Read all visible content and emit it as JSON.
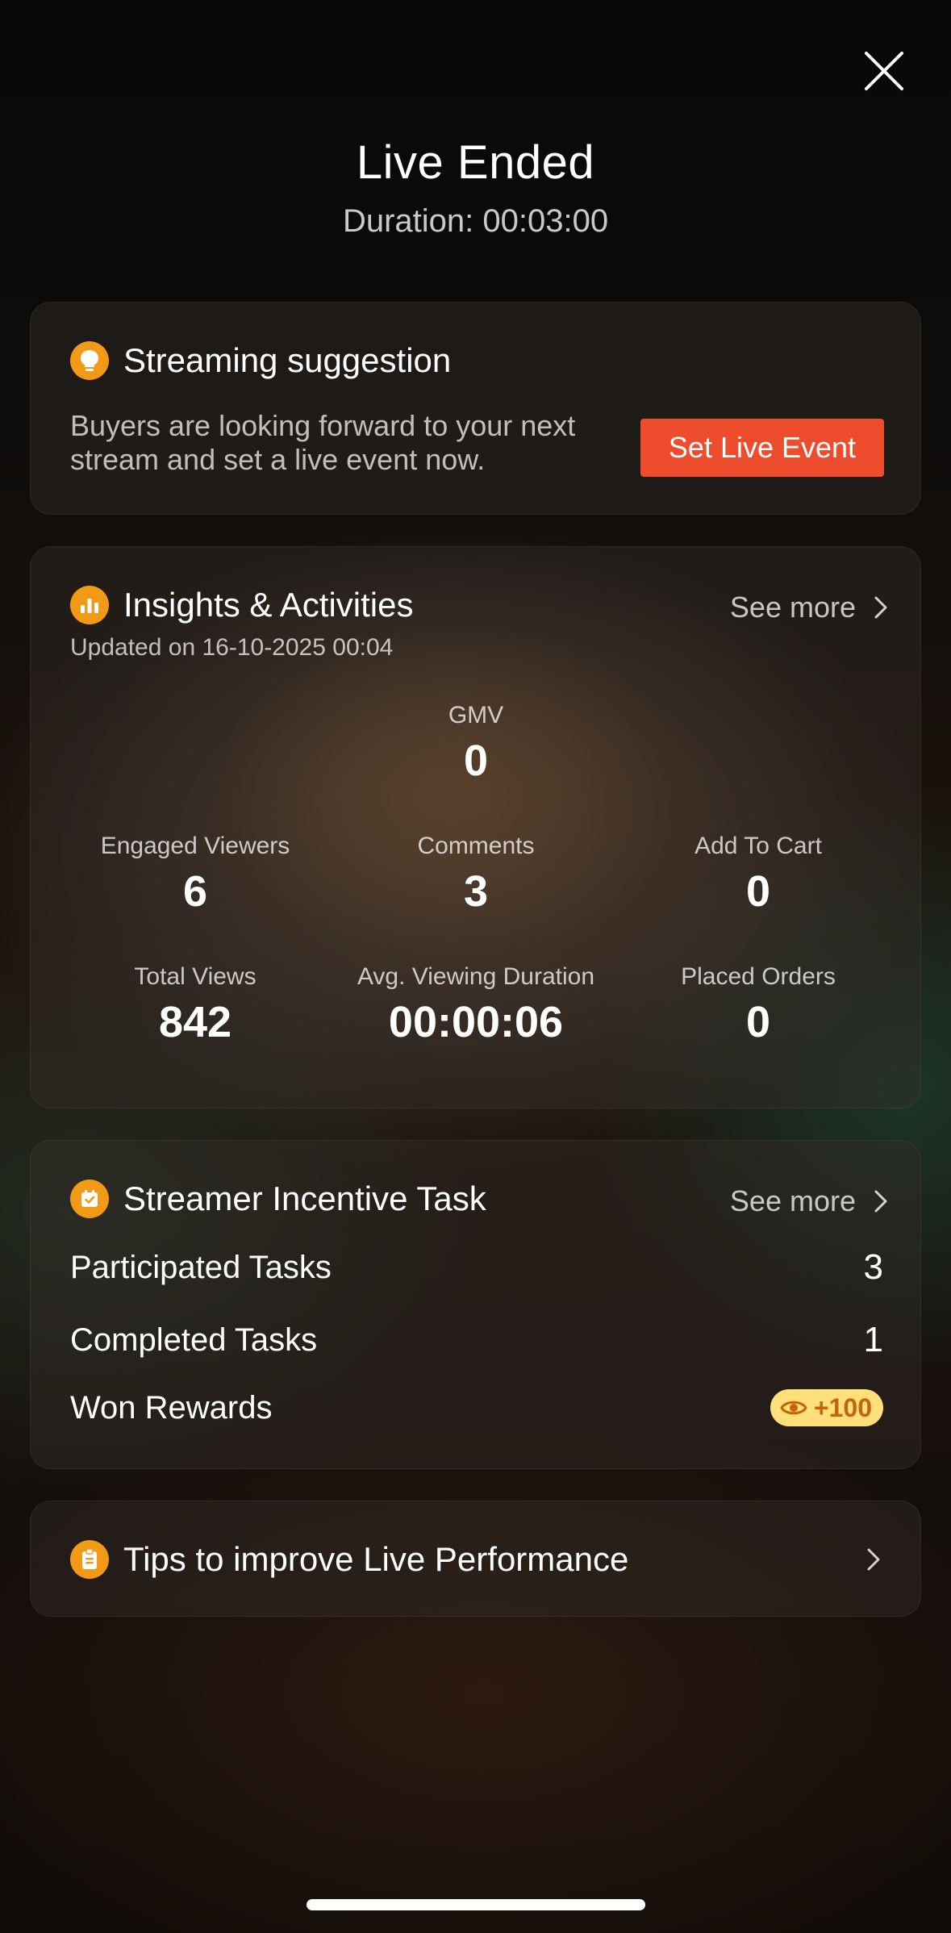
{
  "header": {
    "title": "Live Ended",
    "duration": "Duration: 00:03:00"
  },
  "suggestion": {
    "title": "Streaming suggestion",
    "icon": "lightbulb-icon",
    "text": "Buyers are looking forward to your next stream and set a live event now.",
    "button_label": "Set Live Event"
  },
  "insights": {
    "title": "Insights & Activities",
    "icon": "bar-chart-icon",
    "see_more": "See more",
    "updated": "Updated on 16-10-2025 00:04",
    "gmv": {
      "label": "GMV",
      "value": "0"
    },
    "metrics": [
      {
        "label": "Engaged Viewers",
        "value": "6"
      },
      {
        "label": "Comments",
        "value": "3"
      },
      {
        "label": "Add To Cart",
        "value": "0"
      },
      {
        "label": "Total Views",
        "value": "842"
      },
      {
        "label": "Avg. Viewing Duration",
        "value": "00:00:06"
      },
      {
        "label": "Placed Orders",
        "value": "0"
      }
    ]
  },
  "incentive": {
    "title": "Streamer Incentive Task",
    "icon": "calendar-check-icon",
    "see_more": "See more",
    "rows": [
      {
        "label": "Participated Tasks",
        "value": "3"
      },
      {
        "label": "Completed Tasks",
        "value": "1"
      },
      {
        "label": "Won Rewards",
        "value": "+100"
      }
    ]
  },
  "tips": {
    "title": "Tips to improve Live Performance",
    "icon": "clipboard-icon"
  },
  "colors": {
    "accent_orange": "#f29a18",
    "button_red": "#ee4d2d",
    "reward_bg": "#ffe07a",
    "reward_text": "#c7630b"
  }
}
